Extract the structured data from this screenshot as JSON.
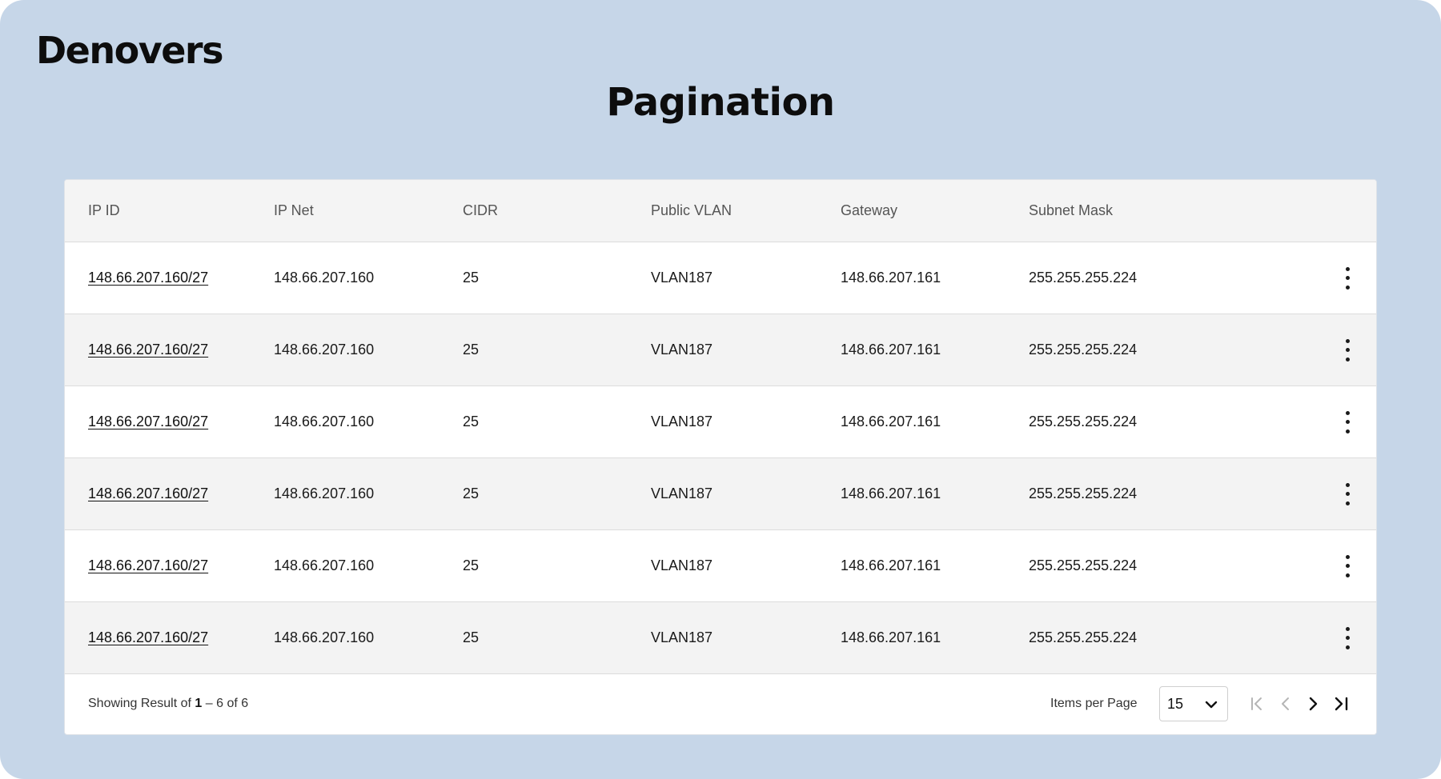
{
  "brand": "Denovers",
  "title": "Pagination",
  "table": {
    "columns": [
      "IP ID",
      "IP Net",
      "CIDR",
      "Public VLAN",
      "Gateway",
      "Subnet Mask"
    ],
    "rows": [
      {
        "ip_id": "148.66.207.160/27",
        "ip_net": "148.66.207.160",
        "cidr": "25",
        "vlan": "VLAN187",
        "gateway": "148.66.207.161",
        "subnet": "255.255.255.224"
      },
      {
        "ip_id": "148.66.207.160/27",
        "ip_net": "148.66.207.160",
        "cidr": "25",
        "vlan": "VLAN187",
        "gateway": "148.66.207.161",
        "subnet": "255.255.255.224"
      },
      {
        "ip_id": "148.66.207.160/27",
        "ip_net": "148.66.207.160",
        "cidr": "25",
        "vlan": "VLAN187",
        "gateway": "148.66.207.161",
        "subnet": "255.255.255.224"
      },
      {
        "ip_id": "148.66.207.160/27",
        "ip_net": "148.66.207.160",
        "cidr": "25",
        "vlan": "VLAN187",
        "gateway": "148.66.207.161",
        "subnet": "255.255.255.224"
      },
      {
        "ip_id": "148.66.207.160/27",
        "ip_net": "148.66.207.160",
        "cidr": "25",
        "vlan": "VLAN187",
        "gateway": "148.66.207.161",
        "subnet": "255.255.255.224"
      },
      {
        "ip_id": "148.66.207.160/27",
        "ip_net": "148.66.207.160",
        "cidr": "25",
        "vlan": "VLAN187",
        "gateway": "148.66.207.161",
        "subnet": "255.255.255.224"
      }
    ],
    "row_action_icon": "kebab-menu-icon"
  },
  "footer": {
    "result_prefix": "Showing Result of ",
    "result_start": "1",
    "result_suffix": " – 6 of 6",
    "items_per_page_label": "Items per Page",
    "items_per_page_value": "15",
    "icons": [
      "chevron-down-icon",
      "first-page-icon",
      "previous-page-icon",
      "next-page-icon",
      "last-page-icon"
    ]
  },
  "colors": {
    "background": "#c6d6e8",
    "header_row": "#f4f4f4",
    "alt_row": "#f3f3f3",
    "disabled_pager": "#b5b5b5",
    "text": "#1a1a1a"
  }
}
